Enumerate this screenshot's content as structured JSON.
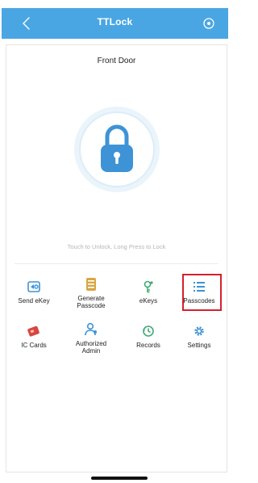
{
  "app": {
    "title": "TTLock"
  },
  "lock": {
    "name": "Front Door",
    "hint": "Touch to Unlock, Long Press to Lock"
  },
  "menu": {
    "items": [
      {
        "label": "Send eKey",
        "icon": "send-ekey-icon"
      },
      {
        "label": "Generate Passcode",
        "icon": "passcode-icon"
      },
      {
        "label": "eKeys",
        "icon": "ekeys-icon"
      },
      {
        "label": "Passcodes",
        "icon": "passcodes-list-icon"
      },
      {
        "label": "IC Cards",
        "icon": "ic-card-icon"
      },
      {
        "label": "Authorized Admin",
        "icon": "admin-icon"
      },
      {
        "label": "Records",
        "icon": "records-icon"
      },
      {
        "label": "Settings",
        "icon": "settings-icon"
      }
    ]
  },
  "colors": {
    "header": "#4aa6e3",
    "accent_blue": "#3d93d6",
    "green": "#3faa74",
    "gold": "#d8a642",
    "red_card": "#d8463e",
    "highlight": "#d81e2c"
  }
}
